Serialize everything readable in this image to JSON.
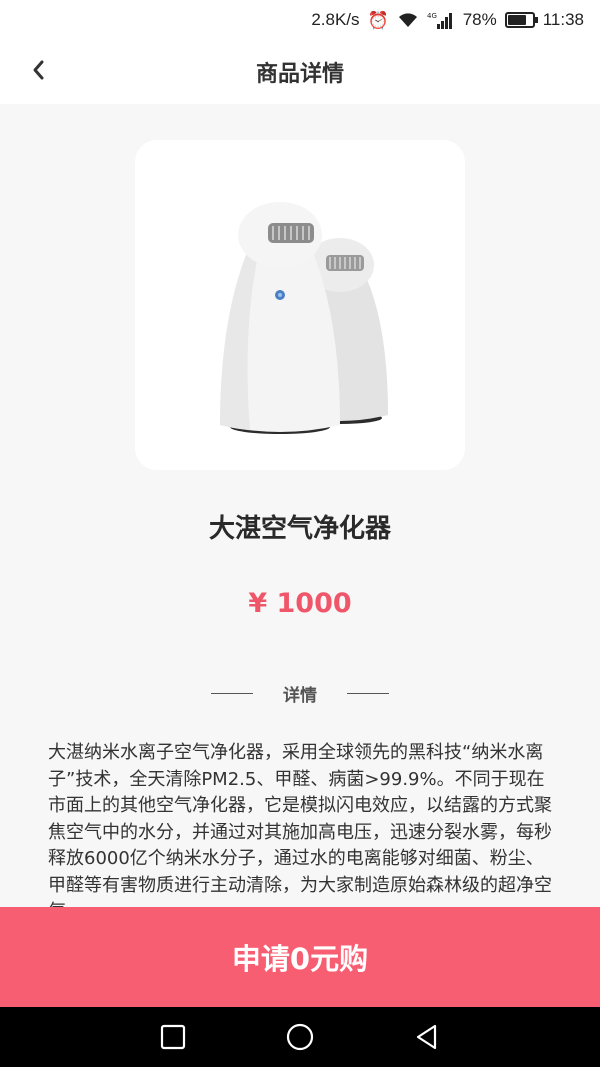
{
  "status_bar": {
    "network_speed": "2.8K/s",
    "battery_percent": "78%",
    "battery_level": 0.78,
    "time": "11:38",
    "icons": [
      "alarm-icon",
      "wifi-icon",
      "signal-4g-icon",
      "battery-icon"
    ]
  },
  "header": {
    "title": "商品详情",
    "back_icon": "chevron-left-icon"
  },
  "product": {
    "image": "air-purifier-product-photo",
    "name": "大湛空气净化器",
    "price": "¥ 1000"
  },
  "details": {
    "section_label": "详情",
    "description": "大湛纳米水离子空气净化器，采用全球领先的黑科技“纳米水离子”技术，全天清除PM2.5、甲醛、病菌>99.9%。不同于现在市面上的其他空气净化器，它是模拟闪电效应，以结露的方式聚焦空气中的水分，并通过对其施加高电压，迅速分裂水雾，每秒释放6000亿个纳米水分子，通过水的电离能够对细菌、粉尘、甲醛等有害物质进行主动清除，为大家制造原始森林级的超净空气。"
  },
  "cta": {
    "label": "申请0元购"
  },
  "nav": {
    "icons": [
      "recent-apps-icon",
      "home-icon",
      "back-icon"
    ]
  },
  "colors": {
    "accent": "#f85e71",
    "price": "#f0566a"
  }
}
